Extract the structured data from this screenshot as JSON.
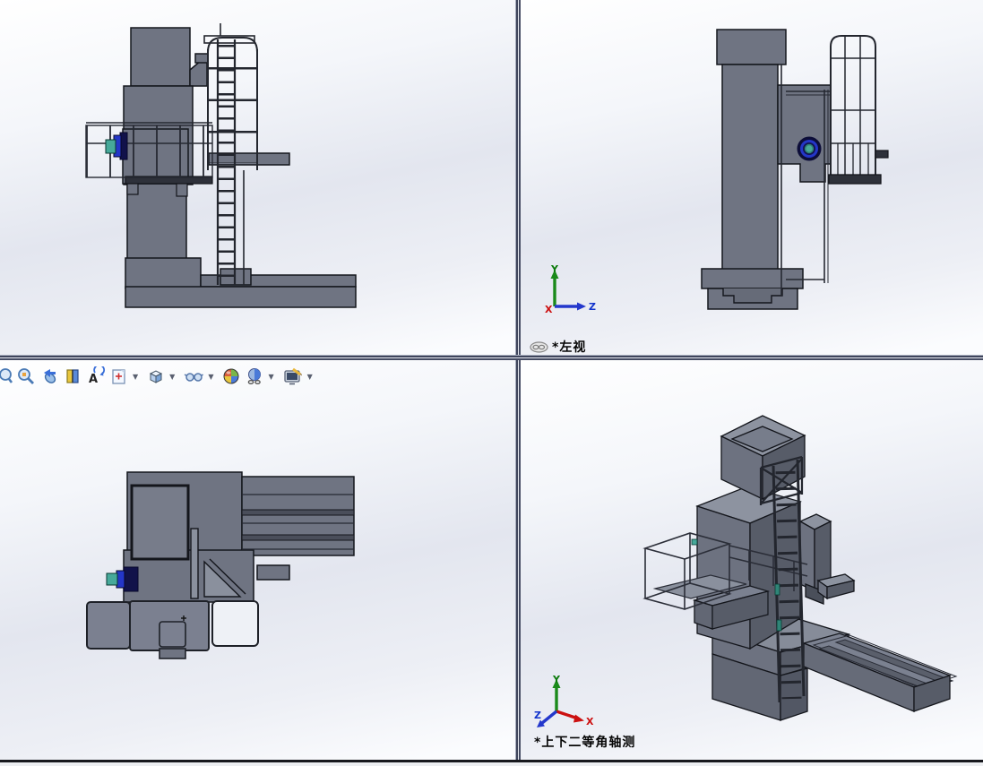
{
  "viewports": {
    "top_left": {
      "name": "front-view",
      "label": ""
    },
    "top_right": {
      "name": "left-view",
      "label": "*左视",
      "has_link_icon": true
    },
    "bottom_left": {
      "name": "top-view",
      "label": ""
    },
    "bottom_right": {
      "name": "dimetric-view",
      "label": "*上下二等角轴测"
    }
  },
  "axis_triad": {
    "x": "X",
    "y": "Y",
    "z": "Z"
  },
  "heads_up_toolbar": {
    "icons": [
      {
        "name": "zoom-to-fit",
        "has_dropdown": false
      },
      {
        "name": "zoom-to-area",
        "has_dropdown": false
      },
      {
        "name": "previous-view",
        "has_dropdown": false
      },
      {
        "name": "section-view",
        "has_dropdown": false
      },
      {
        "name": "rotate-view",
        "has_dropdown": false
      },
      {
        "name": "drawing-view",
        "has_dropdown": true
      },
      {
        "name": "view-orientation",
        "has_dropdown": true
      },
      {
        "name": "hide-show-items",
        "has_dropdown": true
      },
      {
        "name": "edit-appearance",
        "has_dropdown": false
      },
      {
        "name": "apply-scene",
        "has_dropdown": true
      },
      {
        "name": "view-settings",
        "has_dropdown": true
      }
    ]
  },
  "colors": {
    "machine_body": "#6f7482",
    "machine_dark": "#575c68",
    "machine_top": "#8d93a0",
    "edge": "#14161c",
    "platform_slab": "#2e313a",
    "spindle_ring_blue": "#2436c8",
    "spindle_navy": "#0c0d38",
    "spindle_teal": "#46a99a",
    "axis_x": "#cc1111",
    "axis_y": "#1a8a1a",
    "axis_z": "#1133cc"
  }
}
